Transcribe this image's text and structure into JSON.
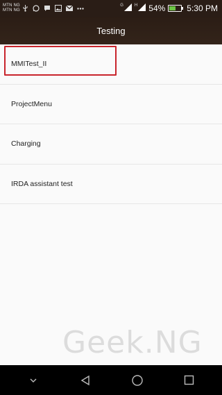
{
  "status_bar": {
    "carrier_1": "MTN NG",
    "carrier_2": "MTN NG",
    "network_1": "G",
    "network_2": "H",
    "battery_percent_text": "54%",
    "battery_level": 0.54,
    "time": "5:30 PM",
    "icons": [
      "usb-icon",
      "whatsapp-icon",
      "message-icon",
      "image-icon",
      "gmail-icon",
      "more-icon",
      "signal-icon",
      "signal-icon",
      "battery-icon"
    ]
  },
  "app_bar": {
    "title": "Testing"
  },
  "list": {
    "items": [
      {
        "label": "MMITest_II"
      },
      {
        "label": "ProjectMenu"
      },
      {
        "label": "Charging"
      },
      {
        "label": "IRDA assistant test"
      }
    ]
  },
  "highlight": {
    "target": "ProjectMenu",
    "color": "#c8242c"
  },
  "watermark": {
    "text": "Geek.NG"
  },
  "nav_bar": {
    "buttons": [
      "collapse-icon",
      "back-icon",
      "home-icon",
      "recents-icon"
    ]
  },
  "colors": {
    "app_bar": "#2b1d15",
    "battery_fill": "#6cc644",
    "background": "#fafafa"
  }
}
